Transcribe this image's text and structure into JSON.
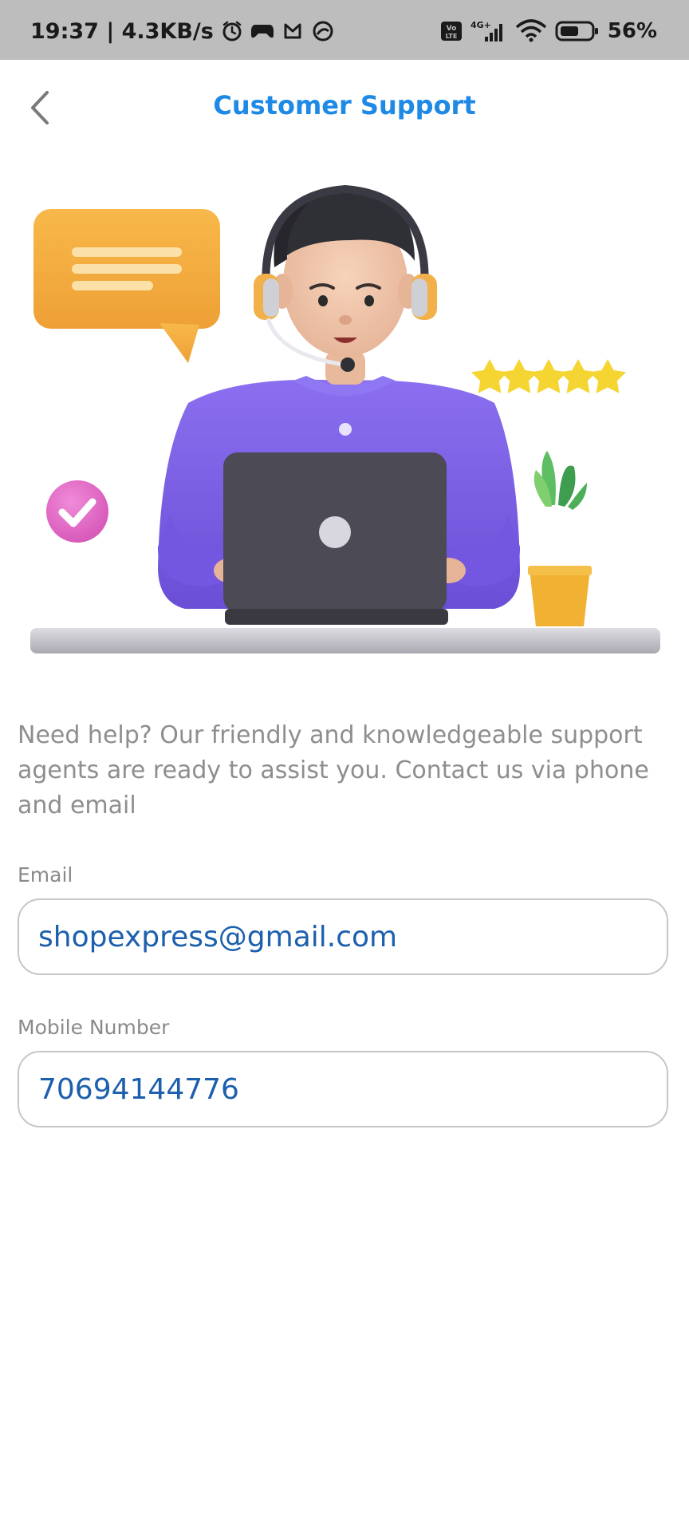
{
  "status_bar": {
    "time_speed": "19:37 | 4.3KB/s",
    "network": "4G+",
    "volte": "Vo LTE",
    "battery": "56%",
    "icons": [
      "alarm-icon",
      "game-icon",
      "mail-app-icon",
      "app-icon",
      "volte-icon",
      "signal-icon",
      "wifi-icon",
      "battery-icon"
    ]
  },
  "header": {
    "title": "Customer Support",
    "back_icon": "chevron-left-icon"
  },
  "illustration": {
    "description_icon": "support-agent-illustration"
  },
  "description": "Need help? Our friendly and knowledgeable support agents are ready to assist you. Contact us via phone and email",
  "contact": {
    "email_label": "Email",
    "email_value": "shopexpress@gmail.com",
    "mobile_label": "Mobile Number",
    "mobile_value": "70694144776"
  },
  "colors": {
    "accent": "#1e8ae6",
    "value_text": "#1b5fad",
    "status_bar": "#bdbdbd"
  }
}
